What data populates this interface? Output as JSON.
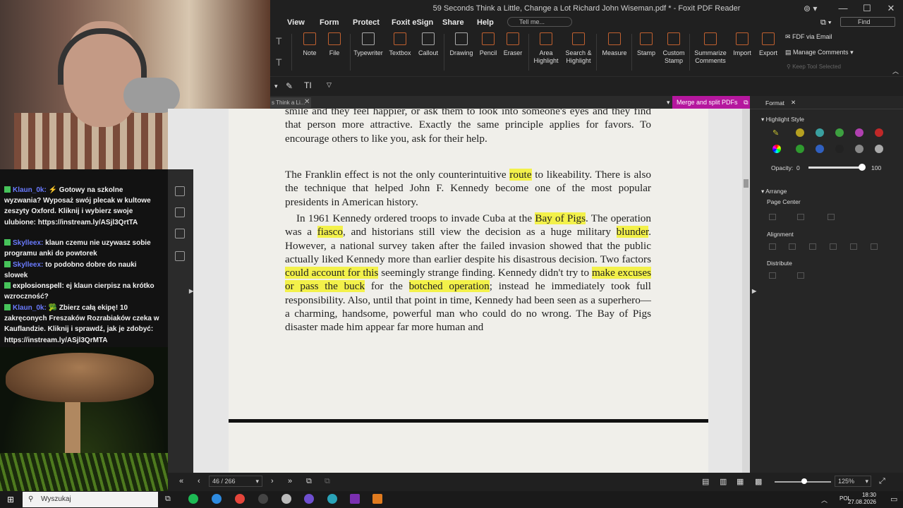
{
  "window": {
    "title": "59 Seconds Think a Little, Change a Lot Richard John Wiseman.pdf * - Foxit PDF Reader",
    "controls": [
      "—",
      "☐",
      "✕"
    ]
  },
  "menu": {
    "items": [
      "View",
      "Form",
      "Protect",
      "Foxit eSign",
      "Share",
      "Help"
    ],
    "tell_me": "Tell me...",
    "find": "Find"
  },
  "ribbon": {
    "buttons": [
      {
        "label": "Note"
      },
      {
        "label": "File"
      },
      {
        "label": "Typewriter"
      },
      {
        "label": "Textbox"
      },
      {
        "label": "Callout"
      },
      {
        "label": "Drawing"
      },
      {
        "label": "Pencil"
      },
      {
        "label": "Eraser"
      },
      {
        "label": "Area\nHighlight"
      },
      {
        "label": "Search &\nHighlight"
      },
      {
        "label": "Measure"
      },
      {
        "label": "Stamp"
      },
      {
        "label": "Custom\nStamp"
      },
      {
        "label": "Summarize\nComments"
      },
      {
        "label": "Import"
      },
      {
        "label": "Export"
      }
    ],
    "fdf_via_email": "FDF via Email",
    "manage_comments": "Manage Comments",
    "keep_tool_selected": "Keep Tool Selected"
  },
  "tabs": {
    "doc_tab": "s Think a Li...",
    "merge_button": "Merge and split PDFs"
  },
  "document": {
    "para1": "smile and they feel happier, or ask them to look into someone's eyes and they find that person more attractive. Exactly the same principle applies for favors. To encourage others to like you, ask for their help.",
    "para2_a": "The Franklin effect is not the only counterintuitive ",
    "para2_h1": "route",
    "para2_b": " to likeability. There is also the technique that helped John F. Kennedy become one of the most popular presidents in American history.",
    "para3_a": "In 1961 Kennedy ordered troops to invade Cuba at the ",
    "para3_h1": "Bay of Pigs",
    "para3_b": ". The operation was a ",
    "para3_h2": "fiasco",
    "para3_c": ", and historians still view the decision as a huge military ",
    "para3_h3": "blunder",
    "para3_d": ". However, a national survey taken after the failed invasion showed that the public actually liked Kennedy more than earlier despite his disastrous decision. Two factors ",
    "para3_h4": "could account for this",
    "para3_e": " seemingly strange finding. Kennedy didn't try to ",
    "para3_h5": "make excuses or pass the buck",
    "para3_f": " for the ",
    "para3_h6": "botched operation",
    "para3_g": "; instead he immediately took full responsibility. Also, until that point in time, Kennedy had been seen as a superhero—a charming, handsome, powerful man who could do no wrong. The Bay of Pigs disaster made him appear far more human and",
    "highlight_color": "#f3f14a"
  },
  "format_panel": {
    "tab": "Format",
    "highlight_style": "Highlight Style",
    "swatches": [
      "#b5a020",
      "#3aa0a0",
      "#3da040",
      "#b040b0",
      "#c02828",
      "#2f9a2f",
      "#3060c0",
      "#222222",
      "#888888",
      "#aaaaaa"
    ],
    "opacity_label": "Opacity:",
    "opacity_min": "0",
    "opacity_max": "100",
    "opacity_value": 100,
    "arrange": "Arrange",
    "page_center": "Page Center",
    "alignment": "Alignment",
    "distribute": "Distribute"
  },
  "status": {
    "page": "46 / 266",
    "zoom": "125%"
  },
  "chat": [
    {
      "user": "Klaun_0k:",
      "text": "⚡ Gotowy na szkolne wyzwania? Wyposaż swój plecak w kultowe zeszyty Oxford. Kliknij i wybierz swoje ulubione: https://instream.ly/ASjl3QrtTA"
    },
    {
      "user": "Skylleex:",
      "text": "klaun czemu nie uzywasz sobie programu anki do powtorek"
    },
    {
      "user": "Skylleex:",
      "text": "to podobno dobre do nauki slowek"
    },
    {
      "user": "explosionspell:",
      "text": "ej klaun cierpisz na krótko wzroczność?"
    },
    {
      "user": "Klaun_0k:",
      "text": "🥦 Zbierz całą ekipę! 10 zakręconych Freszaków Rozrabiaków czeka w Kauflandzie. Kliknij i sprawdź, jak je zdobyć: https://instream.ly/ASjl3QrMTA"
    }
  ],
  "taskbar": {
    "search": "Wyszukaj",
    "lang": "POL",
    "time": "18:30",
    "date": "27.08.2026"
  }
}
